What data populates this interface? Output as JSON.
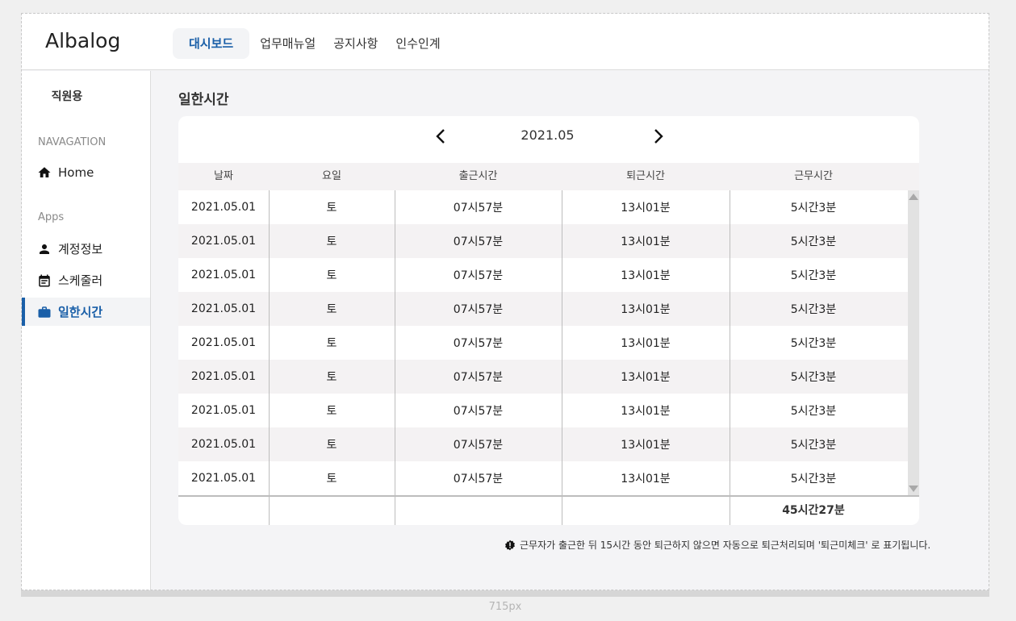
{
  "app": {
    "logo": "Albalog"
  },
  "topnav": {
    "tabs": [
      {
        "label": "대시보드",
        "active": true
      },
      {
        "label": "업무매뉴얼",
        "active": false
      },
      {
        "label": "공지사항",
        "active": false
      },
      {
        "label": "인수인계",
        "active": false
      }
    ]
  },
  "sidebar": {
    "user_role": "직원용",
    "sections": [
      {
        "title": "NAVAGATION"
      },
      {
        "title": "Apps"
      }
    ],
    "items": [
      {
        "label": "Home",
        "icon": "home-icon",
        "active": false
      },
      {
        "label": "계정정보",
        "icon": "person-icon",
        "active": false
      },
      {
        "label": "스케줄러",
        "icon": "calendar-icon",
        "active": false
      },
      {
        "label": "일한시간",
        "icon": "briefcase-icon",
        "active": true
      }
    ]
  },
  "main": {
    "title": "일한시간",
    "month": "2021.05",
    "columns": [
      "날짜",
      "요일",
      "출근시간",
      "퇴근시간",
      "근무시간"
    ],
    "rows": [
      [
        "2021.05.01",
        "토",
        "07시57분",
        "13시01분",
        "5시간3분"
      ],
      [
        "2021.05.01",
        "토",
        "07시57분",
        "13시01분",
        "5시간3분"
      ],
      [
        "2021.05.01",
        "토",
        "07시57분",
        "13시01분",
        "5시간3분"
      ],
      [
        "2021.05.01",
        "토",
        "07시57분",
        "13시01분",
        "5시간3분"
      ],
      [
        "2021.05.01",
        "토",
        "07시57분",
        "13시01분",
        "5시간3분"
      ],
      [
        "2021.05.01",
        "토",
        "07시57분",
        "13시01분",
        "5시간3분"
      ],
      [
        "2021.05.01",
        "토",
        "07시57분",
        "13시01분",
        "5시간3분"
      ],
      [
        "2021.05.01",
        "토",
        "07시57분",
        "13시01분",
        "5시간3분"
      ],
      [
        "2021.05.01",
        "토",
        "07시57분",
        "13시01분",
        "5시간3분"
      ]
    ],
    "total": "45시간27분",
    "notice": "근무자가 출근한 뒤 15시간 동안 퇴근하지 않으면 자동으로 퇴근처리되며 '퇴근미체크' 로 표기됩니다."
  },
  "width_label": "715px",
  "colors": {
    "accent": "#1a5fa8",
    "row_alt": "#f4f2f3",
    "page_bg": "#f4f4f6"
  }
}
